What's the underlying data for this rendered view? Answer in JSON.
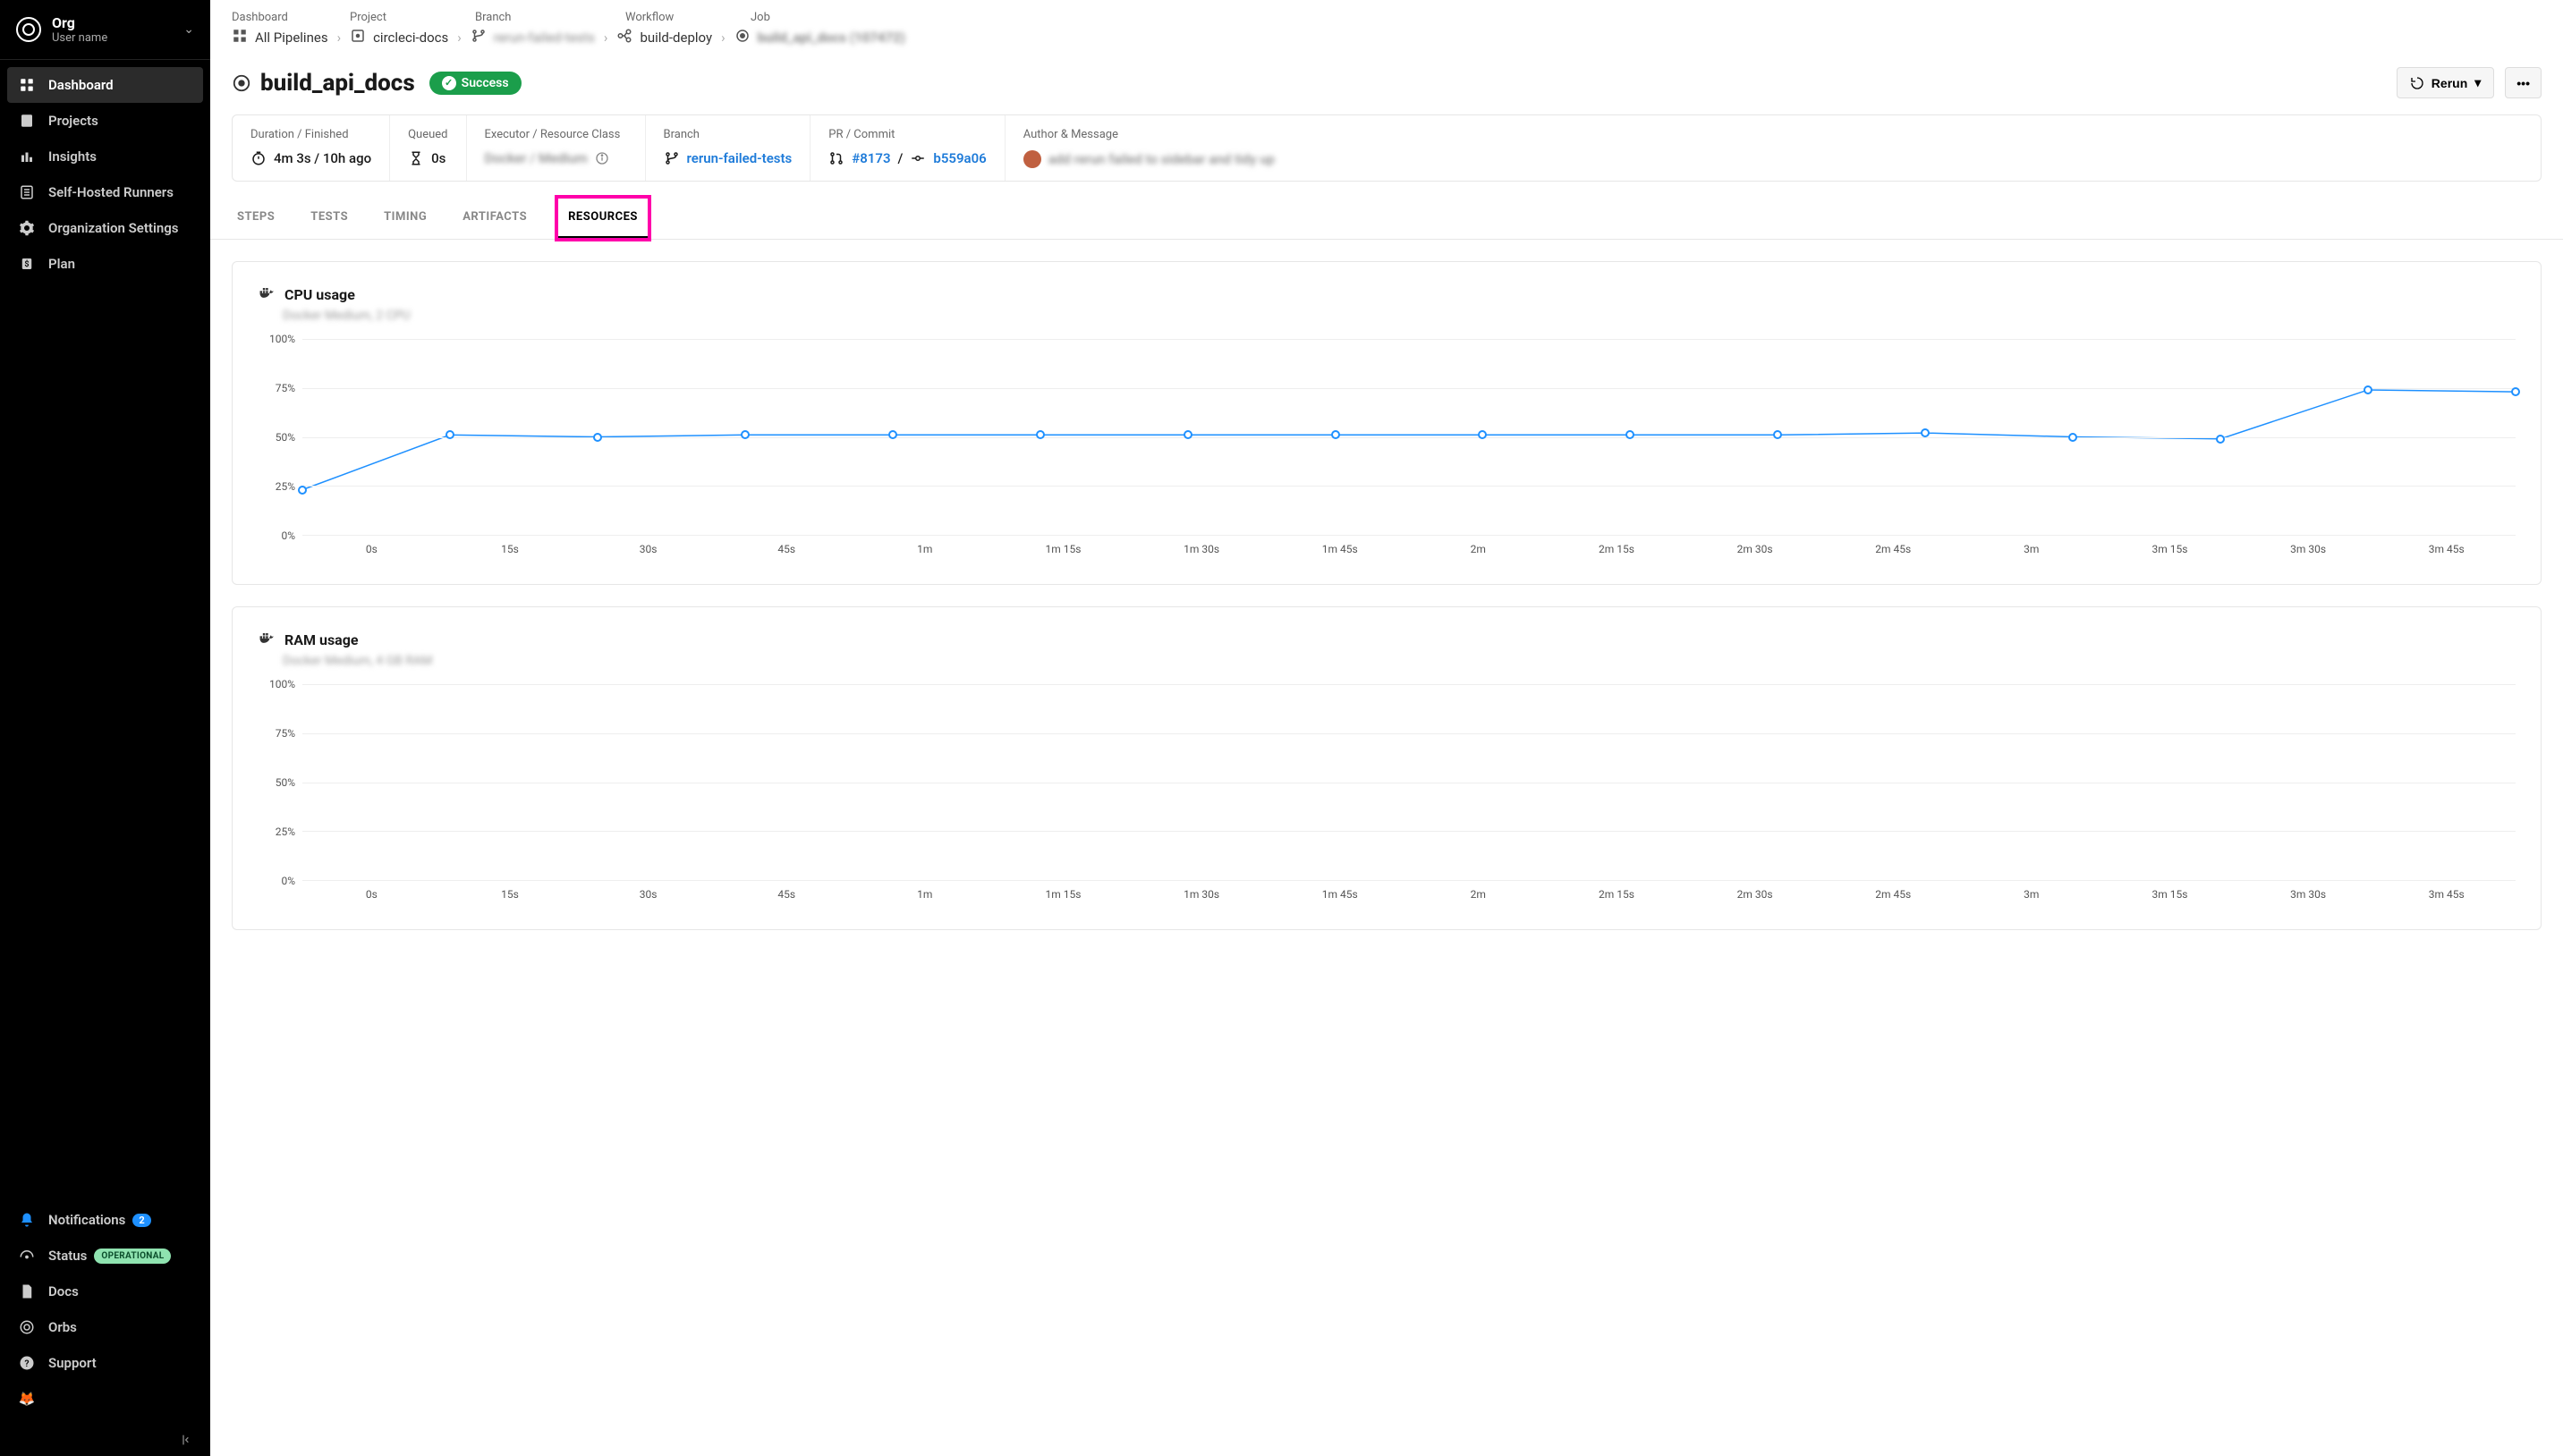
{
  "sidebar": {
    "org_name": "Org",
    "user_name": "User name",
    "nav": [
      {
        "key": "dashboard",
        "label": "Dashboard",
        "active": true
      },
      {
        "key": "projects",
        "label": "Projects"
      },
      {
        "key": "insights",
        "label": "Insights"
      },
      {
        "key": "self-hosted-runners",
        "label": "Self-Hosted Runners"
      },
      {
        "key": "org-settings",
        "label": "Organization Settings"
      },
      {
        "key": "plan",
        "label": "Plan"
      }
    ],
    "bottom": {
      "notifications_label": "Notifications",
      "notifications_count": "2",
      "status_label": "Status",
      "status_value": "OPERATIONAL",
      "docs_label": "Docs",
      "orbs_label": "Orbs",
      "support_label": "Support"
    }
  },
  "breadcrumb": {
    "headers": {
      "dashboard": "Dashboard",
      "project": "Project",
      "branch": "Branch",
      "workflow": "Workflow",
      "job": "Job"
    },
    "dashboard": "All Pipelines",
    "project": "circleci-docs",
    "branch_hidden": "rerun-failed-tests",
    "workflow": "build-deploy",
    "job_hidden": "build_api_docs (107472)"
  },
  "title": {
    "job_name": "build_api_docs",
    "status": "Success",
    "rerun_label": "Rerun"
  },
  "meta": {
    "duration_label": "Duration / Finished",
    "duration_value": "4m 3s / 10h ago",
    "queued_label": "Queued",
    "queued_value": "0s",
    "executor_label": "Executor / Resource Class",
    "executor_text_hidden": "Docker / Medium",
    "branch_label": "Branch",
    "branch_value": "rerun-failed-tests",
    "pr_label": "PR / Commit",
    "pr_number": "#8173",
    "pr_slash": "/",
    "commit_sha": "b559a06",
    "author_label": "Author & Message",
    "author_message_hidden": "add rerun failed to sidebar and tidy up"
  },
  "tabs": [
    {
      "key": "steps",
      "label": "STEPS"
    },
    {
      "key": "tests",
      "label": "TESTS"
    },
    {
      "key": "timing",
      "label": "TIMING"
    },
    {
      "key": "artifacts",
      "label": "ARTIFACTS"
    },
    {
      "key": "resources",
      "label": "RESOURCES",
      "active": true,
      "highlighted": true
    }
  ],
  "charts": {
    "cpu": {
      "title": "CPU usage",
      "subtitle_hidden": "Docker Medium, 2 CPU"
    },
    "ram": {
      "title": "RAM usage",
      "subtitle_hidden": "Docker Medium, 4 GB RAM"
    }
  },
  "chart_data": [
    {
      "type": "line",
      "title": "CPU usage",
      "xlabel": "",
      "ylabel": "",
      "ylim": [
        0,
        100
      ],
      "y_ticks": [
        "0%",
        "25%",
        "50%",
        "75%",
        "100%"
      ],
      "categories": [
        "0s",
        "15s",
        "30s",
        "45s",
        "1m",
        "1m 15s",
        "1m 30s",
        "1m 45s",
        "2m",
        "2m 15s",
        "2m 30s",
        "2m 45s",
        "3m",
        "3m 15s",
        "3m 30s",
        "3m 45s"
      ],
      "values": [
        23,
        51,
        50,
        51,
        51,
        51,
        51,
        51,
        51,
        51,
        51,
        52,
        50,
        49,
        74,
        73
      ]
    },
    {
      "type": "line",
      "title": "RAM usage",
      "xlabel": "",
      "ylabel": "",
      "ylim": [
        0,
        100
      ],
      "y_ticks": [
        "0%",
        "25%",
        "50%",
        "75%",
        "100%"
      ],
      "categories": [
        "0s",
        "15s",
        "30s",
        "45s",
        "1m",
        "1m 15s",
        "1m 30s",
        "1m 45s",
        "2m",
        "2m 15s",
        "2m 30s",
        "2m 45s",
        "3m",
        "3m 15s",
        "3m 30s",
        "3m 45s"
      ],
      "values": []
    }
  ]
}
